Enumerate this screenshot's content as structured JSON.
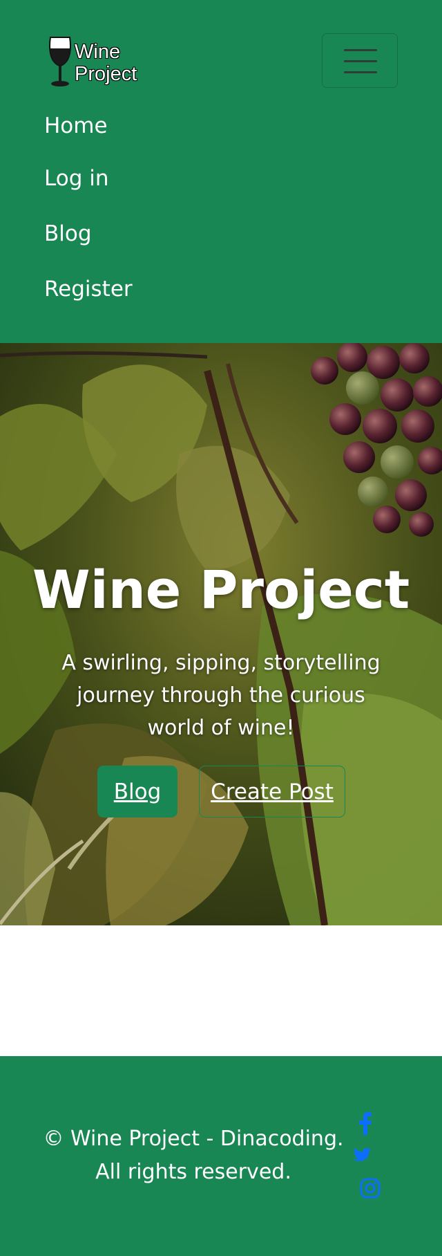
{
  "brand": {
    "line1": "Wine",
    "line2": "Project",
    "logo_icon": "wine-glass-icon"
  },
  "nav": {
    "toggler_icon": "hamburger-menu-icon",
    "items": [
      {
        "label": "Home"
      },
      {
        "label": "Log in"
      },
      {
        "label": "Blog"
      },
      {
        "label": "Register"
      }
    ]
  },
  "hero": {
    "title": "Wine Project",
    "subtitle": "A swirling, sipping, storytelling journey through the curious world of wine!",
    "buttons": {
      "blog": "Blog",
      "create_post": "Create Post"
    },
    "background": "vineyard-grapes-photo"
  },
  "footer": {
    "copyright": "© Wine Project - Dinacoding. All rights reserved.",
    "social": [
      {
        "icon": "facebook-icon"
      },
      {
        "icon": "twitter-icon"
      },
      {
        "icon": "instagram-icon"
      }
    ]
  },
  "colors": {
    "primary": "#198754",
    "social_icon": "#0d6efd",
    "text_light": "#ffffff"
  }
}
